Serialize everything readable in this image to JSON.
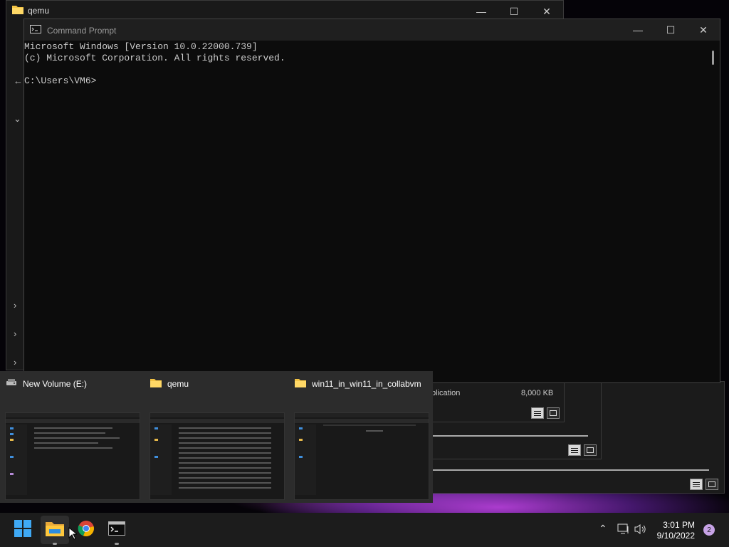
{
  "desktop": {
    "accent": "#b23ed6"
  },
  "qemu_window": {
    "title": "qemu",
    "icon": "folder-icon",
    "partial_text": "plication",
    "partial_size": "8,000 KB"
  },
  "cmd_window": {
    "title": "Command Prompt",
    "icon": "cmd-icon",
    "lines": [
      "Microsoft Windows [Version 10.0.22000.739]",
      "(c) Microsoft Corporation. All rights reserved.",
      "",
      "C:\\Users\\VM6>"
    ]
  },
  "flyout": {
    "thumbnails": [
      {
        "title": "New Volume (E:)",
        "icon": "drive-icon"
      },
      {
        "title": "qemu",
        "icon": "folder-icon"
      },
      {
        "title": "win11_in_win11_in_collabvm",
        "icon": "folder-icon"
      }
    ]
  },
  "taskbar": {
    "apps": [
      {
        "name": "start",
        "icon": "windows-logo-icon"
      },
      {
        "name": "file-explorer",
        "icon": "folder-icon"
      },
      {
        "name": "chrome",
        "icon": "chrome-icon"
      },
      {
        "name": "command-prompt",
        "icon": "cmd-icon"
      }
    ],
    "time": "3:01 PM",
    "date": "9/10/2022",
    "notification_count": "2"
  }
}
